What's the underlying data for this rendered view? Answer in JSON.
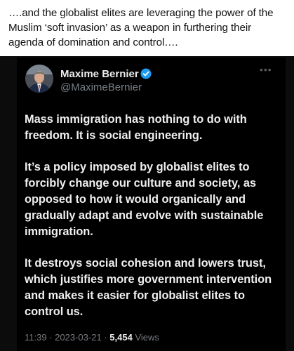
{
  "caption": {
    "text": "….and the globalist elites are leveraging the power of the Muslim ‘soft invasion’ as a weapon in furthering their agenda of domination and control…."
  },
  "tweet": {
    "author_name": "Maxime Bernier",
    "handle": "@MaximeBernier",
    "more_label": "•••",
    "paragraphs": [
      "Mass immigration has nothing to do with freedom. It is social engineering.",
      "It’s a policy imposed by globalist elites to forcibly change our culture and society, as opposed to how it would organically and gradually adapt and evolve with sustainable immigration.",
      "It destroys social cohesion and lowers trust, which justifies more government intervention and makes it easier for globalist elites to control us."
    ],
    "time": "11:39",
    "separator": "·",
    "date": "2023-03-21",
    "views_count": "5,454",
    "views_label": "Views"
  },
  "colors": {
    "verified_badge": "#1d9bf0",
    "background": "#000000",
    "caption_background": "#ffffff"
  },
  "icons": [
    "verified-badge-icon",
    "more-options-icon"
  ]
}
